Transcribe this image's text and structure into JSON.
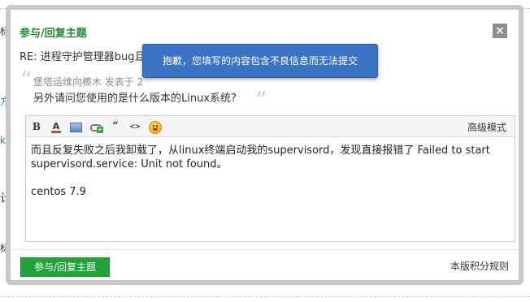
{
  "background": {
    "fragments": [
      "标题",
      "方式",
      "kh",
      "计",
      "标题"
    ]
  },
  "dialog": {
    "title": "参与/回复主题",
    "close_symbol": "×",
    "subject": "RE: 进程守护管理器bug且无法修复 [修改]",
    "quote": {
      "author_line": "堡塔运维向檫木 发表于 2",
      "text": "另外请问您使用的是什么版本的Linux系统?",
      "open_mark": "“",
      "close_mark": "”"
    },
    "tooltip": "抱歉，您填写的内容包含不良信息而无法提交",
    "editor": {
      "toolbar": {
        "bold": "B",
        "font_color": "A",
        "quote": "“",
        "code": "<>",
        "advanced_mode": "高级模式"
      },
      "icons": [
        "bold-icon",
        "font-color-icon",
        "image-icon",
        "link-icon",
        "quote-icon",
        "code-icon",
        "smiley-icon"
      ],
      "content_line1": "而且反复失败之后我卸载了，从linux终端启动我的supervisord，发现直接报错了 Failed to start supervisord.service: Unit not found。",
      "content_line2": "centos 7.9"
    },
    "submit_label": "参与/回复主题",
    "rules_link": "本版积分规则"
  },
  "colors": {
    "title_green": "#1f8a37",
    "button_green": "#21a33b",
    "tooltip_blue": "#3b73c4"
  }
}
